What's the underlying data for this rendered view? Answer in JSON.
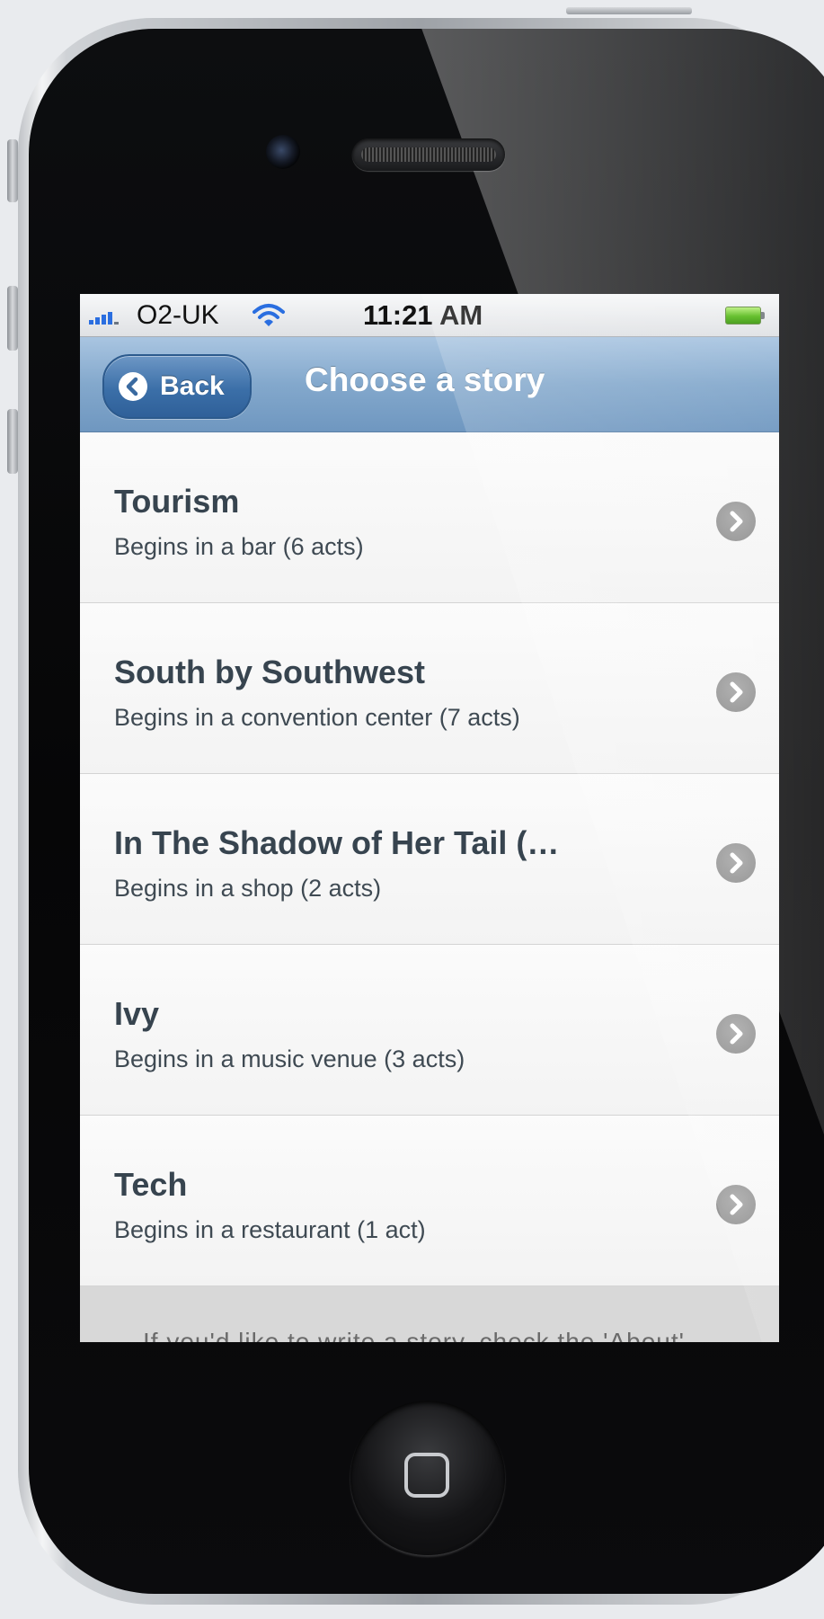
{
  "statusbar": {
    "carrier": "O2-UK",
    "time": "11:21 AM",
    "signal_icon": "signal-bars-icon",
    "wifi_icon": "wifi-icon",
    "battery_icon": "battery-icon",
    "battery_level": 1.0
  },
  "navbar": {
    "back_label": "Back",
    "title": "Choose a story"
  },
  "stories": [
    {
      "title": "Tourism",
      "subtitle": "Begins in a bar (6 acts)"
    },
    {
      "title": "South by Southwest",
      "subtitle": "Begins in a convention center (7 acts)"
    },
    {
      "title": "In The Shadow of Her Tail (…",
      "subtitle": "Begins in a shop (2 acts)"
    },
    {
      "title": "Ivy",
      "subtitle": "Begins in a music venue (3 acts)"
    },
    {
      "title": "Tech",
      "subtitle": "Begins in a restaurant (1 act)"
    }
  ],
  "footer": {
    "text": "If you'd like to write a story, check the 'About'"
  },
  "colors": {
    "navbar": "#83a8cc",
    "title_text": "#37444f",
    "accent_signal": "#2a6ee0",
    "battery": "#5bbb20"
  }
}
